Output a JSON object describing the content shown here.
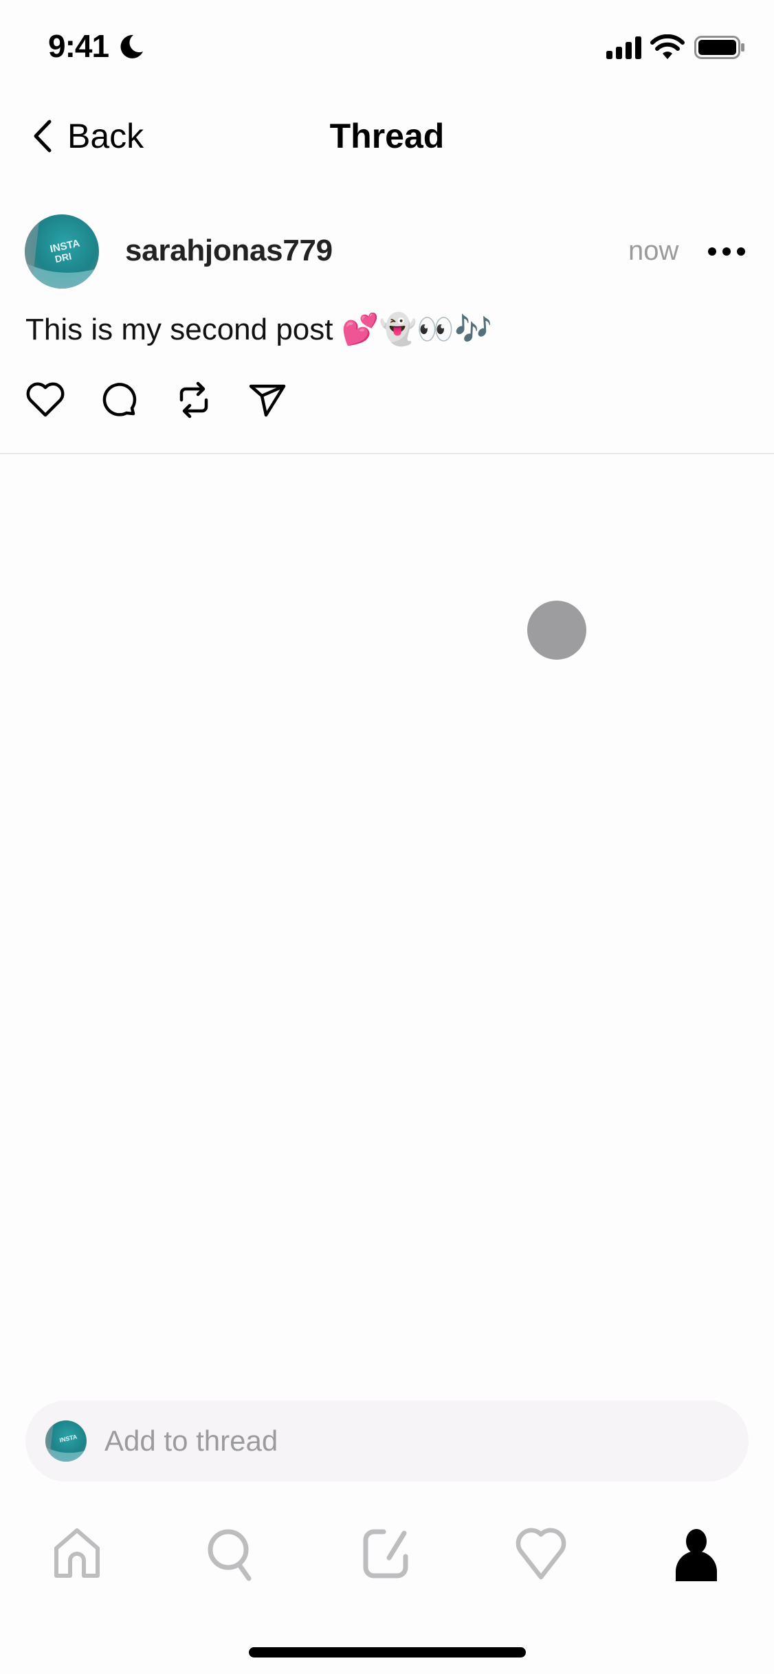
{
  "status_bar": {
    "time": "9:41",
    "icons": [
      "moon-icon",
      "signal-icon",
      "wifi-icon",
      "battery-icon"
    ]
  },
  "nav": {
    "back_label": "Back",
    "title": "Thread"
  },
  "post": {
    "username": "sarahjonas779",
    "timestamp": "now",
    "text": "This is my second post 💕👻👀🎶",
    "actions": [
      "like",
      "comment",
      "repost",
      "share"
    ]
  },
  "composer": {
    "placeholder": "Add to thread"
  },
  "tab_bar": {
    "items": [
      "home",
      "search",
      "compose",
      "activity",
      "profile"
    ],
    "active": "profile"
  },
  "colors": {
    "background": "#fefdfe",
    "muted_text": "#9a9a9a",
    "inactive_tab": "#bdbcbe",
    "composer_bg": "#f6f4f7",
    "avatar_teal": "#1f8e94"
  }
}
